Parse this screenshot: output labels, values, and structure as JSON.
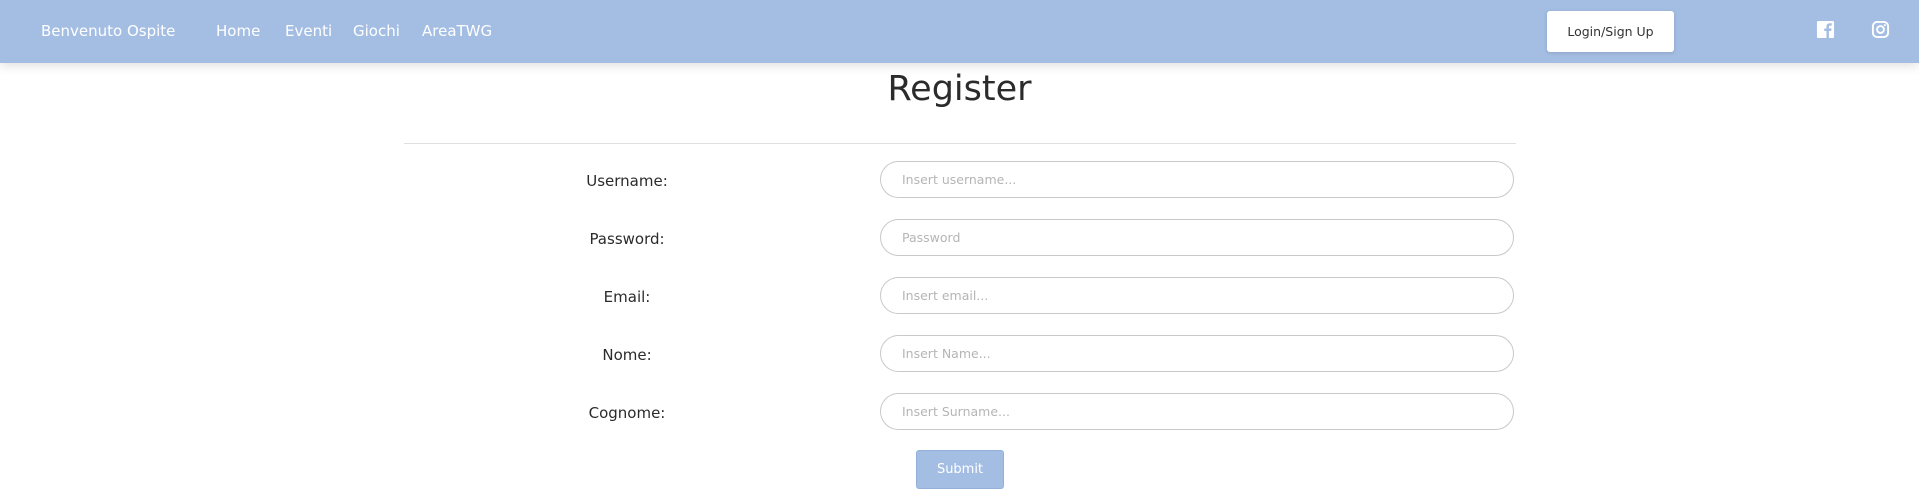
{
  "navbar": {
    "welcome": "Benvenuto Ospite",
    "links": [
      "Home",
      "Eventi",
      "Giochi",
      "AreaTWG"
    ],
    "login_label": "Login/Sign Up",
    "social_icons": [
      "facebook-icon",
      "instagram-icon"
    ],
    "background_color": "#a4bee3"
  },
  "form": {
    "title": "Register",
    "fields": [
      {
        "label": "Username:",
        "placeholder": "Insert username..."
      },
      {
        "label": "Password:",
        "placeholder": "Password"
      },
      {
        "label": "Email:",
        "placeholder": "Insert email..."
      },
      {
        "label": "Nome:",
        "placeholder": "Insert Name..."
      },
      {
        "label": "Cognome:",
        "placeholder": "Insert Surname..."
      }
    ],
    "submit_label": "Submit"
  }
}
